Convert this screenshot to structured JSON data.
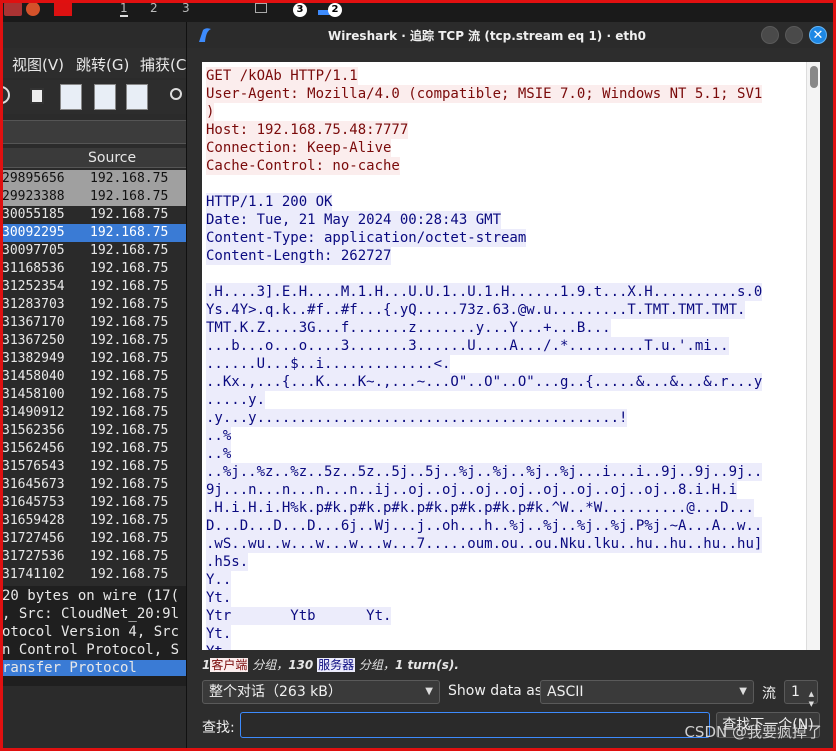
{
  "taskbar": {
    "workspaces": [
      "1",
      "2",
      "3"
    ],
    "badges": [
      "3",
      "2"
    ]
  },
  "main_window": {
    "menu": [
      "视图(V)",
      "跳转(G)",
      "捕获(C"
    ],
    "packet_list": {
      "source_header": "Source",
      "rows": [
        {
          "time": "29895656",
          "source": "192.168.75",
          "style": "gray"
        },
        {
          "time": "29923388",
          "source": "192.168.75",
          "style": "gray"
        },
        {
          "time": "30055185",
          "source": "192.168.75",
          "style": "normal"
        },
        {
          "time": "30092295",
          "source": "192.168.75",
          "style": "selected"
        },
        {
          "time": "30097705",
          "source": "192.168.75",
          "style": "normal"
        },
        {
          "time": "31168536",
          "source": "192.168.75",
          "style": "normal"
        },
        {
          "time": "31252354",
          "source": "192.168.75",
          "style": "normal"
        },
        {
          "time": "31283703",
          "source": "192.168.75",
          "style": "normal"
        },
        {
          "time": "31367170",
          "source": "192.168.75",
          "style": "normal"
        },
        {
          "time": "31367250",
          "source": "192.168.75",
          "style": "normal"
        },
        {
          "time": "31382949",
          "source": "192.168.75",
          "style": "normal"
        },
        {
          "time": "31458040",
          "source": "192.168.75",
          "style": "normal"
        },
        {
          "time": "31458100",
          "source": "192.168.75",
          "style": "normal"
        },
        {
          "time": "31490912",
          "source": "192.168.75",
          "style": "normal"
        },
        {
          "time": "31562356",
          "source": "192.168.75",
          "style": "normal"
        },
        {
          "time": "31562456",
          "source": "192.168.75",
          "style": "normal"
        },
        {
          "time": "31576543",
          "source": "192.168.75",
          "style": "normal"
        },
        {
          "time": "31645673",
          "source": "192.168.75",
          "style": "normal"
        },
        {
          "time": "31645753",
          "source": "192.168.75",
          "style": "normal"
        },
        {
          "time": "31659428",
          "source": "192.168.75",
          "style": "normal"
        },
        {
          "time": "31727456",
          "source": "192.168.75",
          "style": "normal"
        },
        {
          "time": "31727536",
          "source": "192.168.75",
          "style": "normal"
        },
        {
          "time": "31741102",
          "source": "192.168.75",
          "style": "normal"
        }
      ]
    },
    "details": [
      "20 bytes on wire (17(",
      ", Src: CloudNet_20:9l",
      "otocol Version 4, Src",
      "n Control Protocol, S",
      "ransfer Protocol"
    ]
  },
  "dialog": {
    "title": "Wireshark · 追踪 TCP 流 (tcp.stream eq 1) · eth0",
    "close_glyph": "✕",
    "stream_lines": [
      {
        "text": "GET /kOAb HTTP/1.1",
        "side": "client"
      },
      {
        "text": "User-Agent: Mozilla/4.0 (compatible; MSIE 7.0; Windows NT 5.1; SV1",
        "side": "client"
      },
      {
        "text": ")",
        "side": "client"
      },
      {
        "text": "Host: 192.168.75.48:7777",
        "side": "client"
      },
      {
        "text": "Connection: Keep-Alive",
        "side": "client"
      },
      {
        "text": "Cache-Control: no-cache",
        "side": "client"
      },
      {
        "text": "",
        "side": "none"
      },
      {
        "text": "HTTP/1.1 200 OK",
        "side": "server"
      },
      {
        "text": "Date: Tue, 21 May 2024 00:28:43 GMT",
        "side": "server"
      },
      {
        "text": "Content-Type: application/octet-stream",
        "side": "server"
      },
      {
        "text": "Content-Length: 262727",
        "side": "server"
      },
      {
        "text": "",
        "side": "none"
      },
      {
        "text": ".H....3].E.H....M.1.H...U.U.1..U.1.H......1.9.t...X.H..........s.0",
        "side": "server"
      },
      {
        "text": "Ys.4Y>.q.k..#f..#f...{.yQ.....73z.63.@w.u.........T.TMT.TMT.TMT.",
        "side": "server"
      },
      {
        "text": "TMT.K.Z....3G...f.......z.......y...Y...+...B...",
        "side": "server"
      },
      {
        "text": "...b...o...o....3.......3......U....A.../.*.........T.u.'.mi..",
        "side": "server"
      },
      {
        "text": "......U...$..i.............<.",
        "side": "server"
      },
      {
        "text": "..Kx.,...{...K....K~.,...~...O\"..O\"..O\"...g..{.....&...&...&.r...y",
        "side": "server"
      },
      {
        "text": ".....y.",
        "side": "server"
      },
      {
        "text": ".y...y...........................................!",
        "side": "server"
      },
      {
        "text": "..%",
        "side": "server"
      },
      {
        "text": "..%",
        "side": "server"
      },
      {
        "text": "..%j..%z..%z..5z..5z..5j..5j..%j..%j..%j..%j...i...i..9j..9j..9j..",
        "side": "server"
      },
      {
        "text": "9j...n...n...n...n..ij..oj..oj..oj..oj..oj..oj..oj..oj..8.i.H.i",
        "side": "server"
      },
      {
        "text": ".H.i.H.i.H%k.p#k.p#k.p#k.p#k.p#k.p#k.p#k.^W..*W..........@...D...",
        "side": "server"
      },
      {
        "text": "D...D...D...D...6j..Wj...j..oh...h..%j..%j..%j..%j.P%j.~A...A..w..",
        "side": "server"
      },
      {
        "text": ".wS..wu..w...w...w...w...7.....oum.ou..ou.Nku.lku..hu..hu..hu..hu]",
        "side": "server"
      },
      {
        "text": ".h5s.",
        "side": "server"
      },
      {
        "text": "Y..",
        "side": "server"
      },
      {
        "text": "Yt.",
        "side": "server"
      },
      {
        "text": "Ytr       Ytb      Yt.",
        "side": "server"
      },
      {
        "text": "Yt.",
        "side": "server"
      },
      {
        "text": "Yt.",
        "side": "server"
      }
    ],
    "summary": {
      "client_count": "1",
      "client_label": "客户端",
      "packets_word_1": " 分组，",
      "server_count": "130",
      "server_label": "服务器",
      "packets_word_2": " 分组，",
      "turns": "1 turn(s)."
    },
    "conversation_select": "整个对话（263 kB）",
    "show_data_as_label": "Show data as",
    "data_format": "ASCII",
    "stream_label": "流",
    "stream_number": "1",
    "find_label": "查找:",
    "find_value": "",
    "find_next_button": "查找下一个(N)"
  },
  "watermark": "CSDN @我要疯掉了",
  "colors": {
    "client_bg": "#fbeded",
    "client_fg": "#7a0a0a",
    "server_bg": "#ececfb",
    "server_fg": "#0a0a80",
    "selection": "#3a7bd5",
    "frame": "#e01010"
  }
}
